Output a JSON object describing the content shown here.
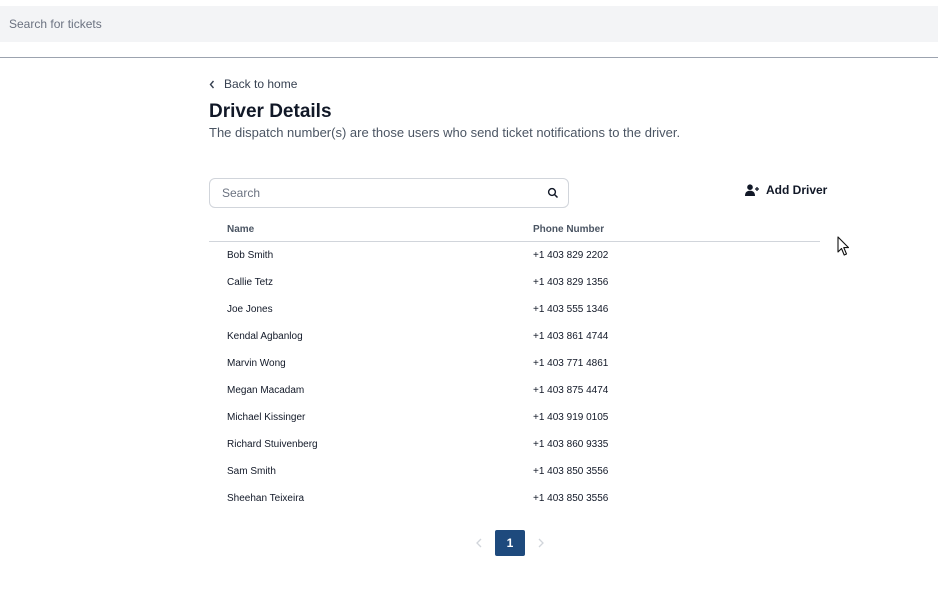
{
  "top_search": {
    "placeholder": "Search for tickets"
  },
  "back_link": {
    "label": "Back to home",
    "icon": "chevron-left-icon"
  },
  "page": {
    "title": "Driver Details",
    "subtitle": "The dispatch number(s) are those users who send ticket notifications to the driver."
  },
  "search": {
    "placeholder": "Search",
    "icon": "search-icon"
  },
  "add_driver": {
    "label": "Add Driver",
    "icon": "user-plus-icon"
  },
  "table": {
    "columns": [
      "Name",
      "Phone Number"
    ],
    "rows": [
      {
        "name": "Bob Smith",
        "phone": "+1 403 829 2202"
      },
      {
        "name": "Callie Tetz",
        "phone": "+1 403 829 1356"
      },
      {
        "name": "Joe Jones",
        "phone": "+1 403 555 1346"
      },
      {
        "name": "Kendal Agbanlog",
        "phone": "+1 403 861 4744"
      },
      {
        "name": "Marvin Wong",
        "phone": "+1 403 771 4861"
      },
      {
        "name": "Megan Macadam",
        "phone": "+1 403 875 4474"
      },
      {
        "name": "Michael Kissinger",
        "phone": "+1 403 919 0105"
      },
      {
        "name": "Richard Stuivenberg",
        "phone": "+1 403 860 9335"
      },
      {
        "name": "Sam Smith",
        "phone": "+1 403 850 3556"
      },
      {
        "name": "Sheehan Teixeira",
        "phone": "+1 403 850 3556"
      }
    ]
  },
  "pagination": {
    "current_page": "1"
  },
  "colors": {
    "accent": "#1e4a7d",
    "topbar_bg": "#f3f4f6"
  }
}
